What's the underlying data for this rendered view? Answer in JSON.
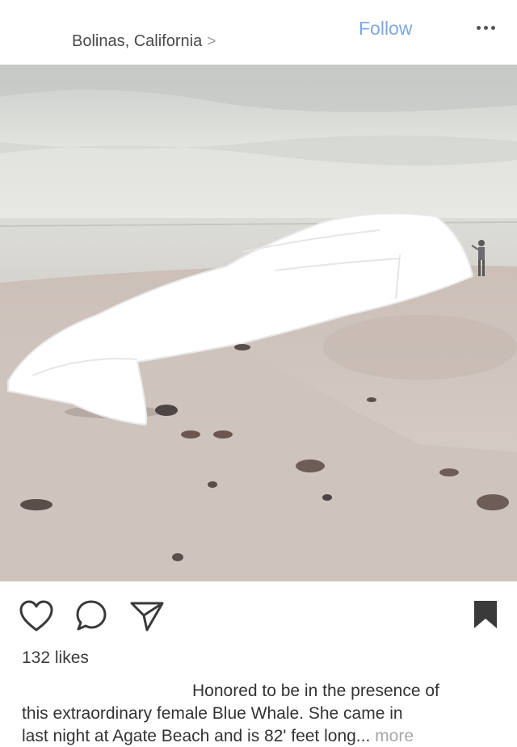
{
  "header": {
    "location": "Bolinas, California",
    "location_chevron": ">",
    "follow_label": "Follow"
  },
  "post": {
    "likes": "132 likes",
    "caption_lines": [
      "Honored to be in the presence of",
      "this extraordinary female Blue Whale.  She came in",
      "last night at Agate Beach and is 82' feet long..."
    ],
    "more_label": "more"
  },
  "colors": {
    "follow": "#7fa8e0",
    "more_link": "#a8a8a8",
    "icon": "#3a3a3a"
  },
  "icons": [
    "heart-icon",
    "comment-icon",
    "share-icon",
    "bookmark-icon",
    "more-dots-icon"
  ]
}
